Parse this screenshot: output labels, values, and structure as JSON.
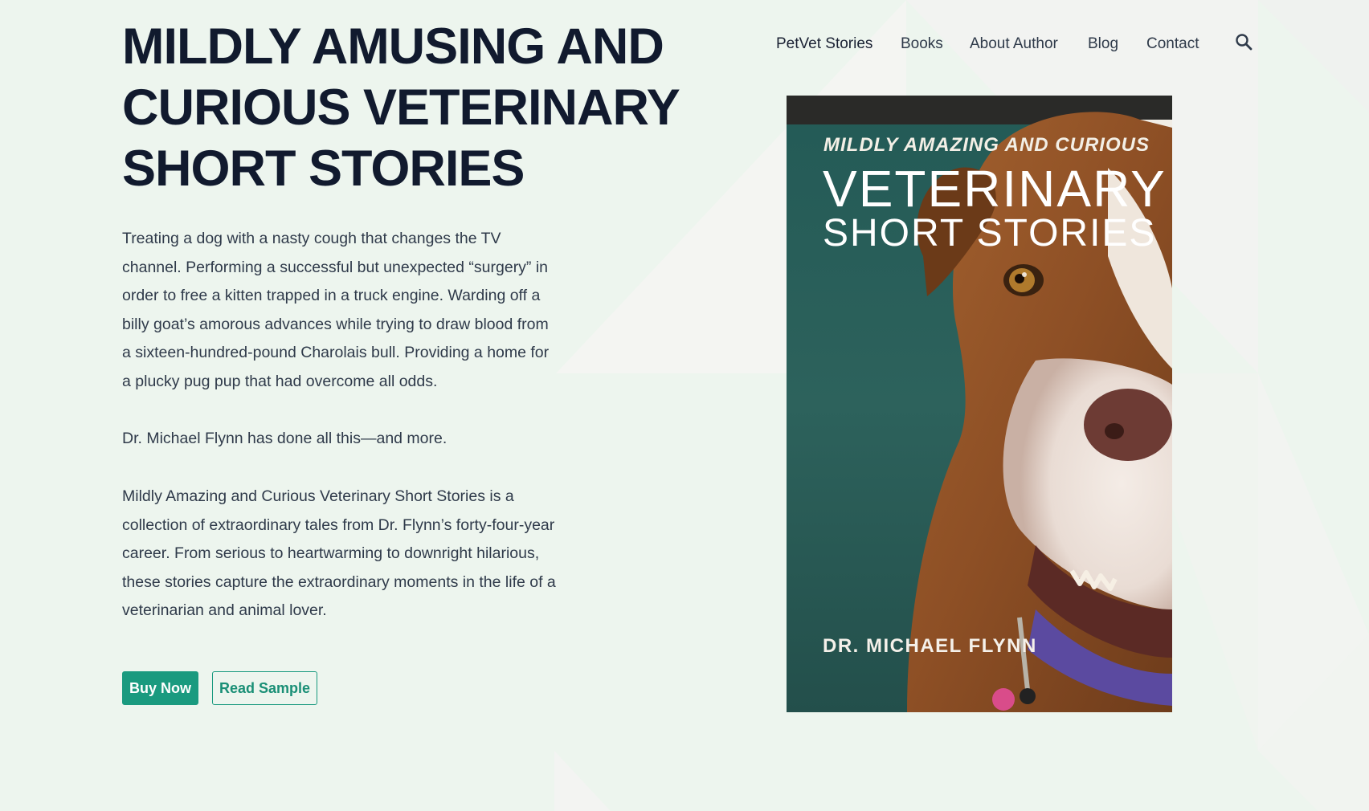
{
  "nav": {
    "items": [
      {
        "label": "PetVet Stories"
      },
      {
        "label": "Books"
      },
      {
        "label": "About Author"
      },
      {
        "label": "Blog"
      },
      {
        "label": "Contact"
      }
    ],
    "search_icon": "search-icon"
  },
  "hero": {
    "title_lines": [
      "MILDLY AMUSING AND",
      "CURIOUS VETERINARY",
      "SHORT STORIES"
    ],
    "paragraphs": [
      "Treating a dog with a nasty cough that changes the TV channel. Performing a successful but unexpected “surgery” in order to free a kitten trapped in a truck engine. Warding off a billy goat’s amorous advances while trying to draw blood from a sixteen-hundred-pound Charolais bull. Providing a home for a plucky pug pup that had overcome all odds.",
      "Dr. Michael Flynn has done all this—and more.",
      "Mildly Amazing and Curious Veterinary Short Stories is a collection of extraordinary tales from Dr. Flynn’s forty-four-year career. From serious to heartwarming to downright hilarious, these stories capture the extraordinary moments in the life of a veterinarian and animal lover."
    ],
    "buy_label": "Buy Now",
    "sample_label": "Read Sample"
  },
  "cover": {
    "kicker": "MILDLY AMAZING AND CURIOUS",
    "title_line_1": "VETERINARY",
    "title_line_2": "SHORT STORIES",
    "author": "DR. MICHAEL FLYNN"
  },
  "colors": {
    "background": "#edf5ee",
    "accent": "#1a9a7f",
    "heading": "#111a2e",
    "body_text": "#2f3a4a"
  }
}
